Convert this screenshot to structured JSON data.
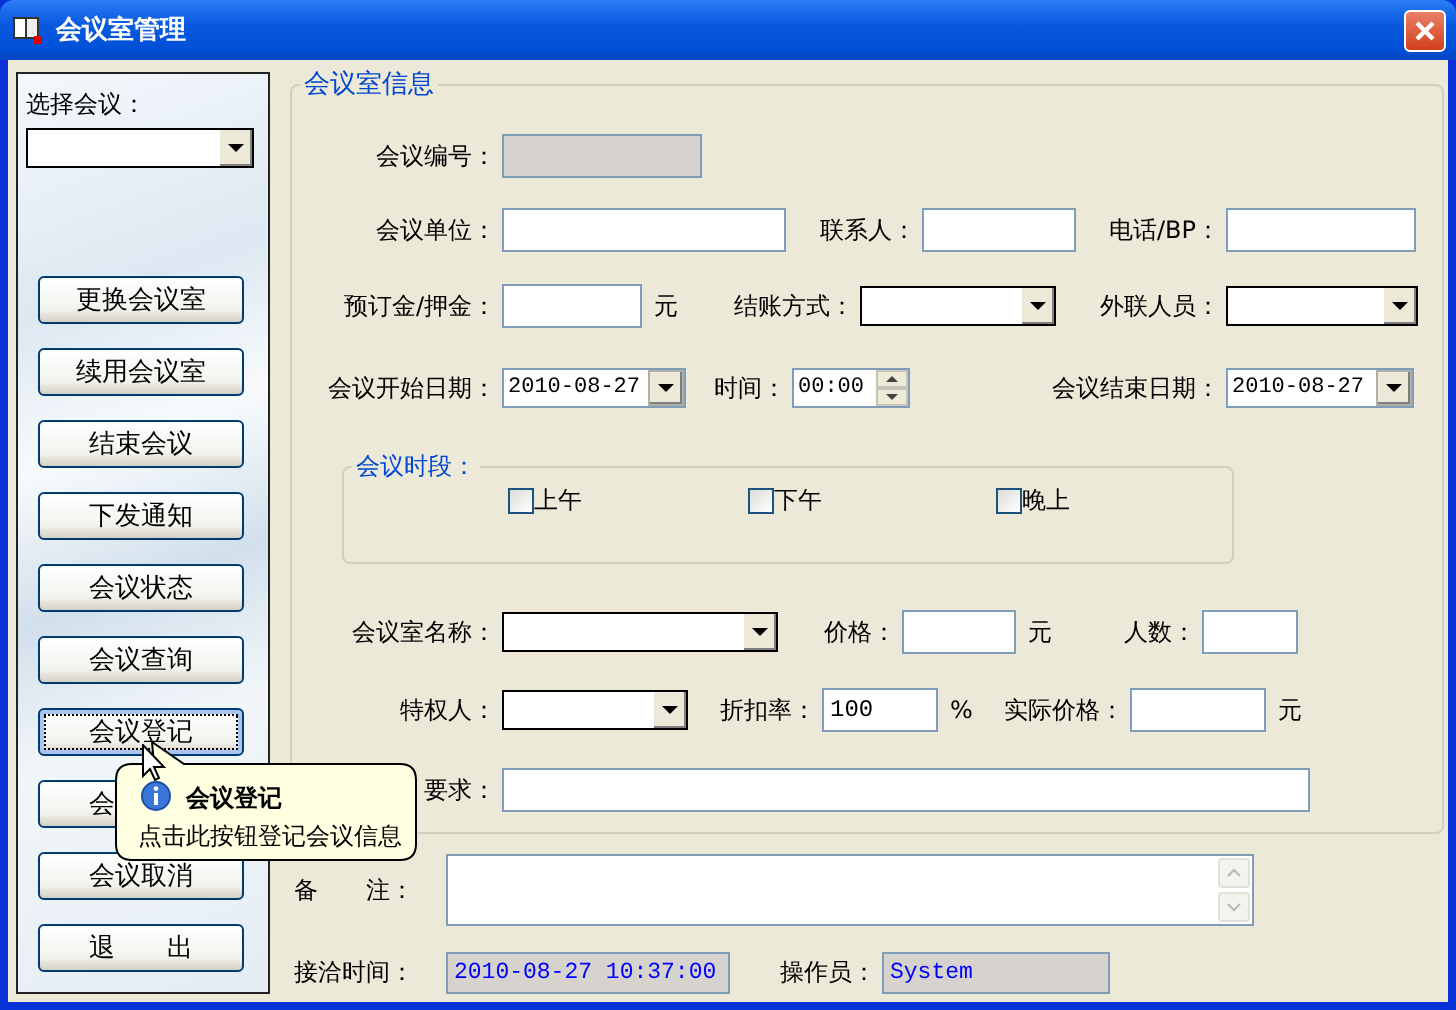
{
  "window": {
    "title": "会议室管理"
  },
  "sidebar": {
    "select_label": "选择会议：",
    "buttons": [
      {
        "label": "更换会议室",
        "focused": false
      },
      {
        "label": "续用会议室",
        "focused": false
      },
      {
        "label": "结束会议",
        "focused": false
      },
      {
        "label": "下发通知",
        "focused": false
      },
      {
        "label": "会议状态",
        "focused": false
      },
      {
        "label": "会议查询",
        "focused": false
      },
      {
        "label": "会议登记",
        "focused": true
      },
      {
        "label": "会",
        "focused": false
      },
      {
        "label": "会议取消",
        "focused": false
      },
      {
        "label": "退　　出",
        "focused": false
      }
    ]
  },
  "group": {
    "title": "会议室信息",
    "sections": [
      {
        "kind": "row",
        "items": [
          {
            "kind": "label",
            "text": "会议编号："
          },
          {
            "kind": "field",
            "disabled": true
          }
        ]
      },
      {
        "kind": "row",
        "items": [
          {
            "kind": "label",
            "text": "会议单位："
          },
          {
            "kind": "field",
            "disabled": false
          },
          {
            "kind": "label",
            "text": "联系人："
          },
          {
            "kind": "field",
            "disabled": false
          },
          {
            "kind": "label",
            "text": "电话/BP："
          },
          {
            "kind": "field",
            "disabled": false
          }
        ]
      },
      {
        "kind": "row",
        "items": [
          {
            "kind": "label",
            "text": "预订金/押金："
          },
          {
            "kind": "field",
            "disabled": false
          },
          {
            "kind": "unit",
            "text": "元"
          },
          {
            "kind": "label",
            "text": "结账方式："
          },
          {
            "kind": "combo"
          },
          {
            "kind": "label",
            "text": "外联人员："
          },
          {
            "kind": "combo"
          }
        ]
      },
      {
        "kind": "row",
        "items": [
          {
            "kind": "label",
            "text": "会议开始日期："
          },
          {
            "kind": "date",
            "value": "2010-08-27"
          },
          {
            "kind": "label",
            "text": "时间："
          },
          {
            "kind": "time",
            "value": "00:00"
          },
          {
            "kind": "label",
            "text": "会议结束日期："
          },
          {
            "kind": "date",
            "value": "2010-08-27"
          }
        ]
      },
      {
        "kind": "period",
        "title": "会议时段：",
        "options": [
          {
            "label": "上午",
            "checked": false
          },
          {
            "label": "下午",
            "checked": false
          },
          {
            "label": "晚上",
            "checked": false
          }
        ]
      },
      {
        "kind": "row",
        "items": [
          {
            "kind": "label",
            "text": "会议室名称："
          },
          {
            "kind": "combo"
          },
          {
            "kind": "label",
            "text": "价格："
          },
          {
            "kind": "field",
            "disabled": false
          },
          {
            "kind": "unit",
            "text": "元"
          },
          {
            "kind": "label",
            "text": "人数："
          },
          {
            "kind": "field",
            "disabled": false
          }
        ]
      },
      {
        "kind": "row",
        "items": [
          {
            "kind": "label",
            "text": "特权人："
          },
          {
            "kind": "combo"
          },
          {
            "kind": "label",
            "text": "折扣率："
          },
          {
            "kind": "field",
            "disabled": false,
            "value": "100"
          },
          {
            "kind": "unit",
            "text": "%"
          },
          {
            "kind": "label",
            "text": "实际价格："
          },
          {
            "kind": "field",
            "disabled": false
          },
          {
            "kind": "unit",
            "text": "元"
          }
        ]
      },
      {
        "kind": "row",
        "items": [
          {
            "kind": "label",
            "text": "要求："
          },
          {
            "kind": "field",
            "disabled": false
          }
        ]
      }
    ]
  },
  "remarks": {
    "label": "备　　注："
  },
  "reception": {
    "label": "接洽时间：",
    "value": "2010-08-27 10:37:00"
  },
  "operator": {
    "label": "操作员：",
    "value": "System"
  },
  "tooltip": {
    "title": "会议登记",
    "text": "点击此按钮登记会议信息"
  }
}
